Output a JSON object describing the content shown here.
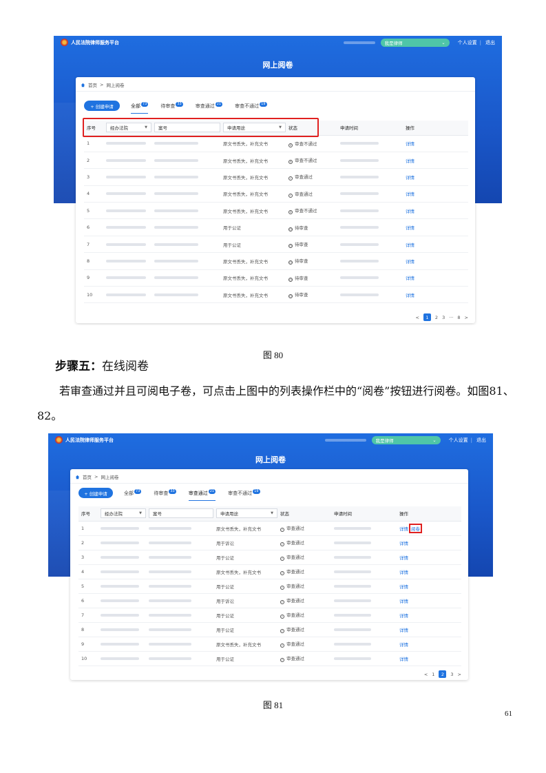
{
  "screenshot1": {
    "app_title": "人民法院律师服务平台",
    "role_select": "我是律师",
    "personal_settings": "个人设置",
    "separator": "|",
    "logout": "退出",
    "page_title": "网上阅卷",
    "breadcrumb": {
      "home": "首页",
      "sep": ">",
      "current": "网上阅卷"
    },
    "create_button": "+ 创建申请",
    "tabs": [
      {
        "label": "全部",
        "badge": "73"
      },
      {
        "label": "待审查",
        "badge": "33"
      },
      {
        "label": "审查通过",
        "badge": "21"
      },
      {
        "label": "审查不通过",
        "badge": "19"
      }
    ],
    "columns": {
      "index": "序号",
      "court": "经办法院",
      "case_no": "案号",
      "purpose": "申请用途",
      "status": "状态",
      "time": "申请时间",
      "action": "操作"
    },
    "rows": [
      {
        "index": "1",
        "purpose": "原文书丢失，补充文书",
        "status": "审查不通过",
        "status_type": "bad",
        "action": "详情"
      },
      {
        "index": "2",
        "purpose": "原文书丢失，补充文书",
        "status": "审查不通过",
        "status_type": "bad",
        "action": "详情"
      },
      {
        "index": "3",
        "purpose": "原文书丢失，补充文书",
        "status": "审查通过",
        "status_type": "ok",
        "action": "详情"
      },
      {
        "index": "4",
        "purpose": "原文书丢失，补充文书",
        "status": "审查通过",
        "status_type": "ok",
        "action": "详情"
      },
      {
        "index": "5",
        "purpose": "原文书丢失，补充文书",
        "status": "审查不通过",
        "status_type": "bad",
        "action": "详情"
      },
      {
        "index": "6",
        "purpose": "用于公证",
        "status": "待审查",
        "status_type": "wait",
        "action": "详情"
      },
      {
        "index": "7",
        "purpose": "用于公证",
        "status": "待审查",
        "status_type": "wait",
        "action": "详情"
      },
      {
        "index": "8",
        "purpose": "原文书丢失，补充文书",
        "status": "待审查",
        "status_type": "wait",
        "action": "详情"
      },
      {
        "index": "9",
        "purpose": "原文书丢失，补充文书",
        "status": "待审查",
        "status_type": "wait",
        "action": "详情"
      },
      {
        "index": "10",
        "purpose": "原文书丢失，补充文书",
        "status": "待审查",
        "status_type": "wait",
        "action": "详情"
      }
    ],
    "pager": [
      "<",
      "1",
      "2",
      "3",
      "···",
      "8",
      ">"
    ],
    "pager_current": "1"
  },
  "caption1": "图 80",
  "step": {
    "bold": "步骤五：",
    "text": "在线阅卷"
  },
  "paragraph": "若审查通过并且可阅电子卷，可点击上图中的列表操作栏中的“阅卷”按钮进行阅卷。如图81、82。",
  "screenshot2": {
    "app_title": "人民法院律师服务平台",
    "role_select": "我是律师",
    "personal_settings": "个人设置",
    "separator": "|",
    "logout": "退出",
    "page_title": "网上阅卷",
    "breadcrumb": {
      "home": "首页",
      "sep": ">",
      "current": "网上阅卷"
    },
    "create_button": "+ 创建申请",
    "tabs": [
      {
        "label": "全部",
        "badge": "73"
      },
      {
        "label": "待审查",
        "badge": "33"
      },
      {
        "label": "审查通过",
        "badge": "21"
      },
      {
        "label": "审查不通过",
        "badge": "19"
      }
    ],
    "columns": {
      "index": "序号",
      "court": "经办法院",
      "case_no": "案号",
      "purpose": "申请用途",
      "status": "状态",
      "time": "申请时间",
      "action": "操作"
    },
    "rows": [
      {
        "index": "1",
        "purpose": "原文书丢失，补充文书",
        "status": "审查通过",
        "status_type": "ok",
        "action": "详情",
        "extra_action": "阅卷"
      },
      {
        "index": "2",
        "purpose": "用于诉讼",
        "status": "审查通过",
        "status_type": "ok",
        "action": "详情"
      },
      {
        "index": "3",
        "purpose": "用于公证",
        "status": "审查通过",
        "status_type": "ok",
        "action": "详情"
      },
      {
        "index": "4",
        "purpose": "原文书丢失，补充文书",
        "status": "审查通过",
        "status_type": "ok",
        "action": "详情"
      },
      {
        "index": "5",
        "purpose": "用于公证",
        "status": "审查通过",
        "status_type": "ok",
        "action": "详情"
      },
      {
        "index": "6",
        "purpose": "用于诉讼",
        "status": "审查通过",
        "status_type": "ok",
        "action": "详情"
      },
      {
        "index": "7",
        "purpose": "用于公证",
        "status": "审查通过",
        "status_type": "ok",
        "action": "详情"
      },
      {
        "index": "8",
        "purpose": "用于公证",
        "status": "审查通过",
        "status_type": "ok",
        "action": "详情"
      },
      {
        "index": "9",
        "purpose": "原文书丢失，补充文书",
        "status": "审查通过",
        "status_type": "ok",
        "action": "详情"
      },
      {
        "index": "10",
        "purpose": "用于公证",
        "status": "审查通过",
        "status_type": "ok",
        "action": "详情"
      }
    ],
    "pager": [
      "<",
      "1",
      "2",
      "3",
      ">"
    ],
    "pager_current": "2"
  },
  "caption2": "图 81",
  "page_number": "61",
  "colors": {
    "primary": "#1f73e0",
    "ok": "#19a86a",
    "bad": "#e04848",
    "highlight": "#e0201f",
    "banner": "#1a57c9"
  }
}
